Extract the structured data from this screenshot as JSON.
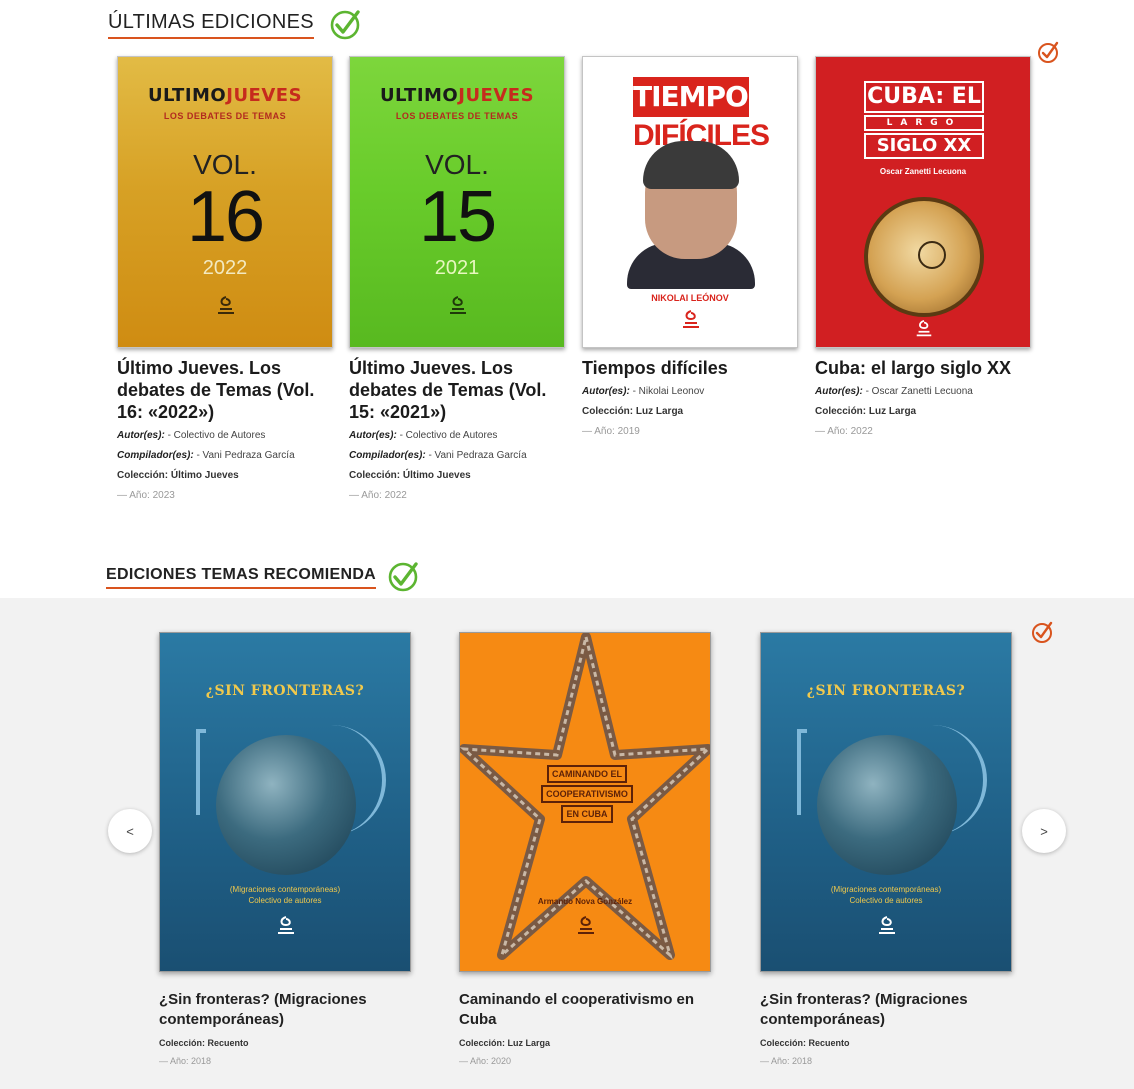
{
  "sections": {
    "latest_title": "ÚLTIMAS EDICIONES",
    "recommend_title": "EDICIONES TEMAS RECOMIENDA"
  },
  "latest": [
    {
      "title": "Último Jueves. Los debates de Temas (Vol. 16: «2022»)",
      "cover": {
        "brand_a": "ULTIMO",
        "brand_j": "J",
        "brand_b": "UEVES",
        "subtitle": "LOS DEBATES DE TEMAS",
        "vol": "VOL.",
        "number": "16",
        "year": "2022",
        "bg": "#d49a1e"
      },
      "author_label": "Autor(es):",
      "author": "- Colectivo de Autores",
      "compiler_label": "Compilador(es):",
      "compiler": "- Vani Pedraza García",
      "collection": "Colección: Último Jueves",
      "year": "— Año: 2023"
    },
    {
      "title": "Último Jueves. Los debates de Temas (Vol. 15: «2021»)",
      "cover": {
        "brand_a": "ULTIMO",
        "brand_j": "J",
        "brand_b": "UEVES",
        "subtitle": "LOS DEBATES DE TEMAS",
        "vol": "VOL.",
        "number": "15",
        "year": "2021",
        "bg": "#6bcf2e"
      },
      "author_label": "Autor(es):",
      "author": "- Colectivo de Autores",
      "compiler_label": "Compilador(es):",
      "compiler": "- Vani Pedraza García",
      "collection": "Colección: Último Jueves",
      "year": "— Año: 2022"
    },
    {
      "title": "Tiempos difíciles",
      "cover": {
        "line1": "TIEMPOS",
        "line2": "DIFÍCILES",
        "author": "NIKOLAI LEÓNOV"
      },
      "author_label": "Autor(es):",
      "author": "- Nikolai Leonov",
      "collection": "Colección: Luz Larga",
      "year": "— Año: 2019"
    },
    {
      "title": "Cuba: el largo siglo XX",
      "cover": {
        "line1": "CUBA: EL",
        "line2": "LARGO",
        "line3": "SIGLO XX",
        "author": "Oscar Zanetti Lecuona"
      },
      "author_label": "Autor(es):",
      "author": "- Oscar Zanetti Lecuona",
      "collection": "Colección: Luz Larga",
      "year": "— Año: 2022"
    }
  ],
  "recommended": [
    {
      "title": "¿Sin fronteras? (Migraciones contemporáneas)",
      "cover": {
        "heading": "¿SIN FRONTERAS?",
        "sub1": "(Migraciones contemporáneas)",
        "sub2": "Colectivo de autores"
      },
      "collection": "Colección: Recuento",
      "year": "— Año: 2018"
    },
    {
      "title": "Caminando el cooperativismo en Cuba",
      "cover": {
        "l1": "CAMINANDO EL",
        "l2": "COOPERATIVISMO",
        "l3": "EN CUBA",
        "author": "Armando Nova González"
      },
      "collection": "Colección: Luz Larga",
      "year": "— Año: 2020"
    },
    {
      "title": "¿Sin fronteras? (Migraciones contemporáneas)",
      "cover": {
        "heading": "¿SIN FRONTERAS?",
        "sub1": "(Migraciones contemporáneas)",
        "sub2": "Colectivo de autores"
      },
      "collection": "Colección: Recuento",
      "year": "— Año: 2018"
    }
  ],
  "carousel": {
    "prev": "<",
    "next": ">"
  },
  "colors": {
    "accent": "#d9541e",
    "check_green": "#5cb531",
    "check_orange": "#d9541e",
    "band_bg": "#f2f2f2"
  }
}
